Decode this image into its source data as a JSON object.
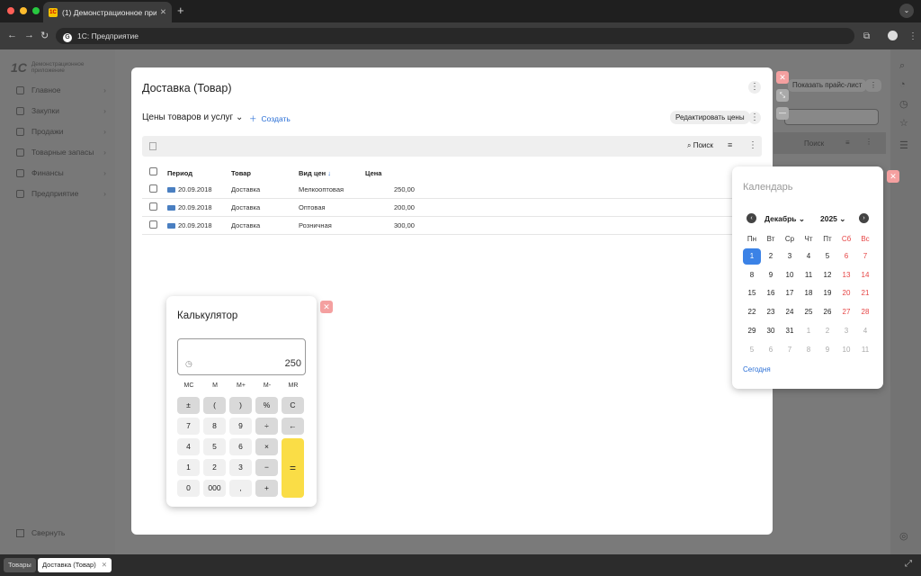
{
  "browser": {
    "tab_title": "(1) Демонстрационное прил",
    "tab_favicon": "1С",
    "url": "1С: Предприятие"
  },
  "sidebar": {
    "logo_text": "Демонстрационное приложение",
    "items": [
      {
        "label": "Главное"
      },
      {
        "label": "Закупки"
      },
      {
        "label": "Продажи"
      },
      {
        "label": "Товарные запасы"
      },
      {
        "label": "Финансы"
      },
      {
        "label": "Предприятие"
      }
    ],
    "collapse_label": "Свернуть"
  },
  "background": {
    "show_price_list": "Показать прайс-лист",
    "search": "Поиск"
  },
  "taskbar": {
    "tabs": [
      "Товары",
      "Доставка (Товар)"
    ]
  },
  "modal": {
    "title": "Доставка (Товар)",
    "subtitle": "Цены товаров и услуг",
    "create": "Создать",
    "edit_prices": "Редактировать цены",
    "search": "Поиск",
    "columns": [
      "Период",
      "Товар",
      "Вид цен",
      "Цена"
    ],
    "rows": [
      {
        "period": "20.09.2018",
        "item": "Доставка",
        "price_type": "Мелкооптовая",
        "price": "250,00"
      },
      {
        "period": "20.09.2018",
        "item": "Доставка",
        "price_type": "Оптовая",
        "price": "200,00"
      },
      {
        "period": "20.09.2018",
        "item": "Доставка",
        "price_type": "Розничная",
        "price": "300,00"
      }
    ]
  },
  "calculator": {
    "title": "Калькулятор",
    "display": "250",
    "memory": [
      "MC",
      "M",
      "M+",
      "M-",
      "MR"
    ],
    "keys": [
      [
        "±",
        "(",
        ")",
        "%",
        "C"
      ],
      [
        "7",
        "8",
        "9",
        "÷",
        "←"
      ],
      [
        "4",
        "5",
        "6",
        "×"
      ],
      [
        "1",
        "2",
        "3",
        "−"
      ],
      [
        "0",
        "000",
        ",",
        "+"
      ]
    ],
    "equals": "="
  },
  "calendar": {
    "title": "Календарь",
    "month": "Декабрь",
    "year": "2025",
    "weekdays": [
      "Пн",
      "Вт",
      "Ср",
      "Чт",
      "Пт",
      "Сб",
      "Вс"
    ],
    "weeks": [
      [
        "1",
        "2",
        "3",
        "4",
        "5",
        "6",
        "7"
      ],
      [
        "8",
        "9",
        "10",
        "11",
        "12",
        "13",
        "14"
      ],
      [
        "15",
        "16",
        "17",
        "18",
        "19",
        "20",
        "21"
      ],
      [
        "22",
        "23",
        "24",
        "25",
        "26",
        "27",
        "28"
      ],
      [
        "29",
        "30",
        "31",
        "1",
        "2",
        "3",
        "4"
      ],
      [
        "5",
        "6",
        "7",
        "8",
        "9",
        "10",
        "11"
      ]
    ],
    "selected_day": "1",
    "today": "Сегодня",
    "weekend_color": "#e64545",
    "selected_color": "#3b82e6"
  }
}
